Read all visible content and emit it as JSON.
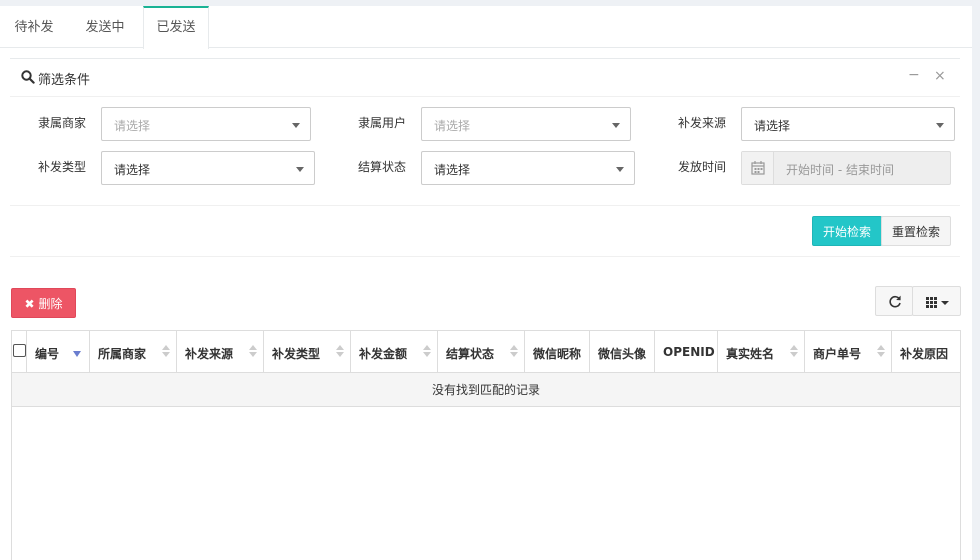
{
  "tabs": [
    {
      "label": "待补发"
    },
    {
      "label": "发送中"
    },
    {
      "label": "已发送"
    }
  ],
  "active_tab": "已发送",
  "filter": {
    "title": "筛选条件",
    "minimize_symbol": "−",
    "close_symbol": "×",
    "fields": [
      {
        "label": "隶属商家",
        "value": "请选择",
        "placeholder": true
      },
      {
        "label": "隶属用户",
        "value": "请选择",
        "placeholder": true
      },
      {
        "label": "补发来源",
        "value": "请选择",
        "placeholder": false
      },
      {
        "label": "补发类型",
        "value": "请选择",
        "placeholder": false
      },
      {
        "label": "结算状态",
        "value": "请选择",
        "placeholder": false
      },
      {
        "label": "发放时间",
        "value": "开始时间 - 结束时间",
        "placeholder": true
      }
    ],
    "search_label": "开始检索",
    "reset_label": "重置检索"
  },
  "toolbar": {
    "delete_label": "删除"
  },
  "table": {
    "columns": [
      "编号",
      "所属商家",
      "补发来源",
      "补发类型",
      "补发金额",
      "结算状态",
      "微信昵称",
      "微信头像",
      "OPENID",
      "真实姓名",
      "商户单号",
      "补发原因"
    ],
    "empty_text": "没有找到匹配的记录"
  },
  "colors": {
    "accent_tab": "#1ab394",
    "search_button": "#23c6c8",
    "delete_button": "#ed5565",
    "sort_active": "#6a7dcf"
  }
}
